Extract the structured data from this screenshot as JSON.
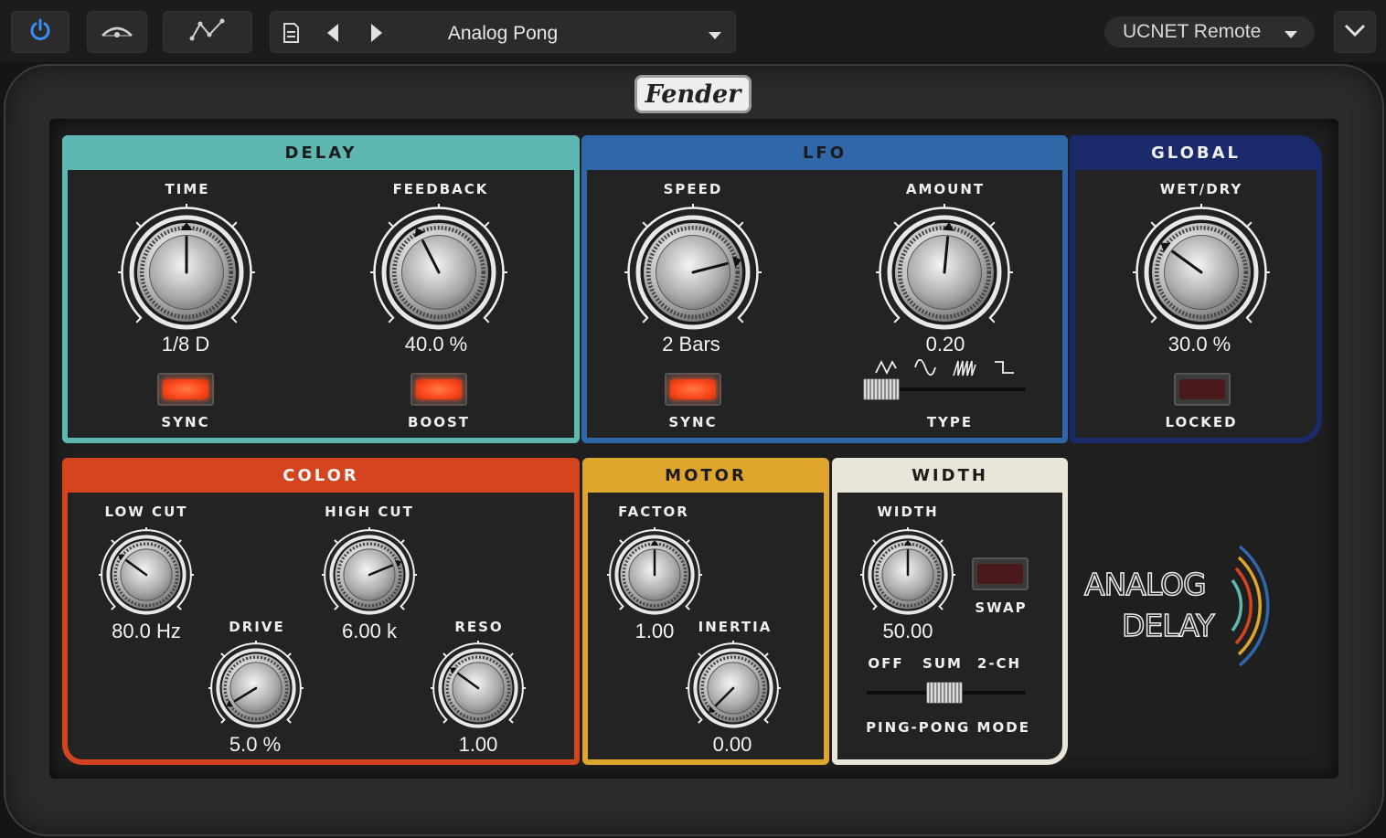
{
  "toolbar": {
    "preset_name": "Analog Pong",
    "remote_label": "UCNET Remote",
    "icons": [
      "power-icon",
      "bypass-icon",
      "automation-icon",
      "preset-menu-icon",
      "prev-icon",
      "next-icon",
      "dropdown-icon",
      "expand-icon"
    ],
    "accent": "#3b8df5"
  },
  "badge": {
    "text": "Fender"
  },
  "logo": {
    "line1": "ANALOG",
    "line2": "DELAY"
  },
  "colors": {
    "delay": "#5fb7b2",
    "lfo": "#2f67a8",
    "global": "#1a2a6a",
    "color": "#d4451f",
    "motor": "#e0a52c",
    "width": "#e9e5d8",
    "led_on": "#ff4a1c"
  },
  "sections": {
    "delay": {
      "title": "DELAY",
      "time": {
        "label": "TIME",
        "value": "1/8 D",
        "level": 0.5
      },
      "feedback": {
        "label": "FEEDBACK",
        "value": "40.0 %",
        "level": 0.4
      },
      "sync": {
        "label": "SYNC",
        "on": true
      },
      "boost": {
        "label": "BOOST",
        "on": true
      }
    },
    "lfo": {
      "title": "LFO",
      "speed": {
        "label": "SPEED",
        "value": "2 Bars",
        "level": 0.78
      },
      "amount": {
        "label": "AMOUNT",
        "value": "0.20",
        "level": 0.52
      },
      "sync": {
        "label": "SYNC",
        "on": true
      },
      "type": {
        "label": "TYPE",
        "selected_index": 0,
        "options": [
          "triangle",
          "sine",
          "saw",
          "square"
        ]
      }
    },
    "global": {
      "title": "GLOBAL",
      "wet_dry": {
        "label": "WET/DRY",
        "value": "30.0 %",
        "level": 0.3
      },
      "locked": {
        "label": "LOCKED",
        "on": false
      }
    },
    "color": {
      "title": "COLOR",
      "low_cut": {
        "label": "LOW CUT",
        "value": "80.0 Hz",
        "level": 0.3
      },
      "high_cut": {
        "label": "HIGH CUT",
        "value": "6.00 k",
        "level": 0.75
      },
      "drive": {
        "label": "DRIVE",
        "value": "5.0 %",
        "level": 0.05
      },
      "reso": {
        "label": "RESO",
        "value": "1.00",
        "level": 0.3
      }
    },
    "motor": {
      "title": "MOTOR",
      "factor": {
        "label": "FACTOR",
        "value": "1.00",
        "level": 0.5
      },
      "inertia": {
        "label": "INERTIA",
        "value": "0.00",
        "level": 0.0
      }
    },
    "width": {
      "title": "WIDTH",
      "width": {
        "label": "WIDTH",
        "value": "50.00",
        "level": 0.5
      },
      "swap": {
        "label": "SWAP",
        "on": false
      },
      "mode": {
        "label": "PING-PONG MODE",
        "options": [
          "OFF",
          "SUM",
          "2-CH"
        ],
        "selected": "SUM"
      }
    }
  }
}
